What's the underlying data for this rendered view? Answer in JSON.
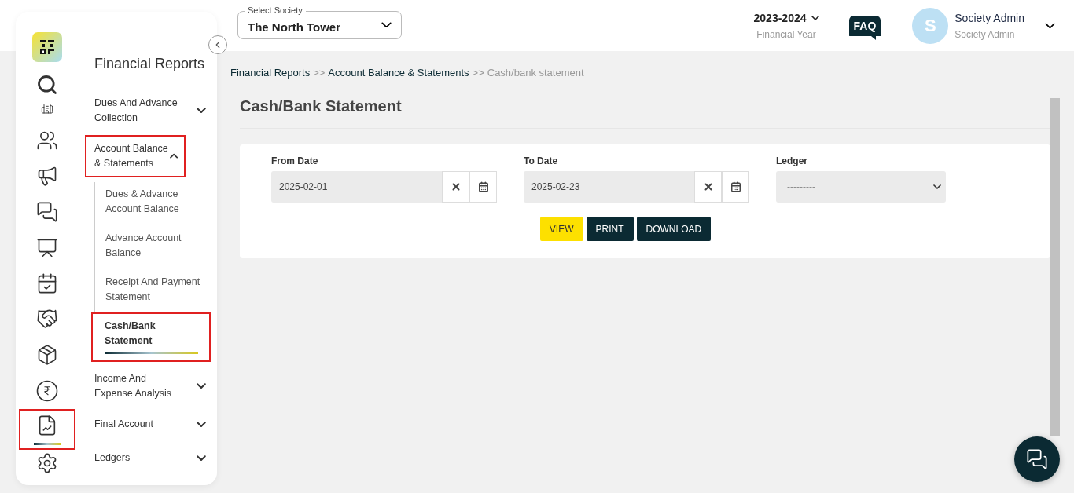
{
  "rail": [
    {
      "kind": "search",
      "selected": false
    },
    {
      "kind": "building",
      "selected": false
    },
    {
      "kind": "people",
      "selected": false
    },
    {
      "kind": "megaphone",
      "selected": false
    },
    {
      "kind": "chat",
      "selected": false
    },
    {
      "kind": "desk",
      "selected": false
    },
    {
      "kind": "calendar",
      "selected": false
    },
    {
      "kind": "handshake",
      "selected": false
    },
    {
      "kind": "box",
      "selected": false
    },
    {
      "kind": "rupee",
      "selected": false
    },
    {
      "kind": "report",
      "selected": true
    },
    {
      "kind": "settings",
      "selected": false
    }
  ],
  "menu": {
    "title": "Financial Reports",
    "items": [
      {
        "label": "Dues And Advance Collection",
        "expanded": false,
        "selected": false
      },
      {
        "label": "Account Balance & Statements",
        "expanded": true,
        "selected": true,
        "children": [
          {
            "label": "Dues & Advance Account Balance",
            "selected": false
          },
          {
            "label": "Advance Account Balance",
            "selected": false
          },
          {
            "label": "Receipt And Payment Statement",
            "selected": false
          },
          {
            "label": "Cash/Bank Statement",
            "selected": true
          }
        ]
      },
      {
        "label": "Income And Expense Analysis",
        "expanded": false,
        "selected": false
      },
      {
        "label": "Final Account",
        "expanded": false,
        "selected": false
      },
      {
        "label": "Ledgers",
        "expanded": false,
        "selected": false
      }
    ]
  },
  "header": {
    "society": {
      "label": "Select Society",
      "value": "The North Tower"
    },
    "year": {
      "value": "2023-2024",
      "label": "Financial Year"
    },
    "faq": "FAQ",
    "user": {
      "initial": "S",
      "name": "Society Admin",
      "role": "Society Admin"
    }
  },
  "breadcrumb": [
    {
      "label": "Financial Reports",
      "current": false
    },
    {
      "label": "Account Balance & Statements",
      "current": false
    },
    {
      "label": "Cash/bank statement",
      "current": true
    }
  ],
  "breadcrumb_separator": ">>",
  "page_title": "Cash/Bank Statement",
  "form": {
    "fields": [
      {
        "kind": "date",
        "label": "From Date",
        "value": "2025-02-01"
      },
      {
        "kind": "date",
        "label": "To Date",
        "value": "2025-02-23"
      },
      {
        "kind": "select",
        "label": "Ledger",
        "placeholder": "---------"
      }
    ],
    "buttons": [
      {
        "label": "VIEW",
        "kind": "primary"
      },
      {
        "label": "PRINT",
        "kind": "dark"
      },
      {
        "label": "DOWNLOAD",
        "kind": "dark"
      }
    ]
  }
}
